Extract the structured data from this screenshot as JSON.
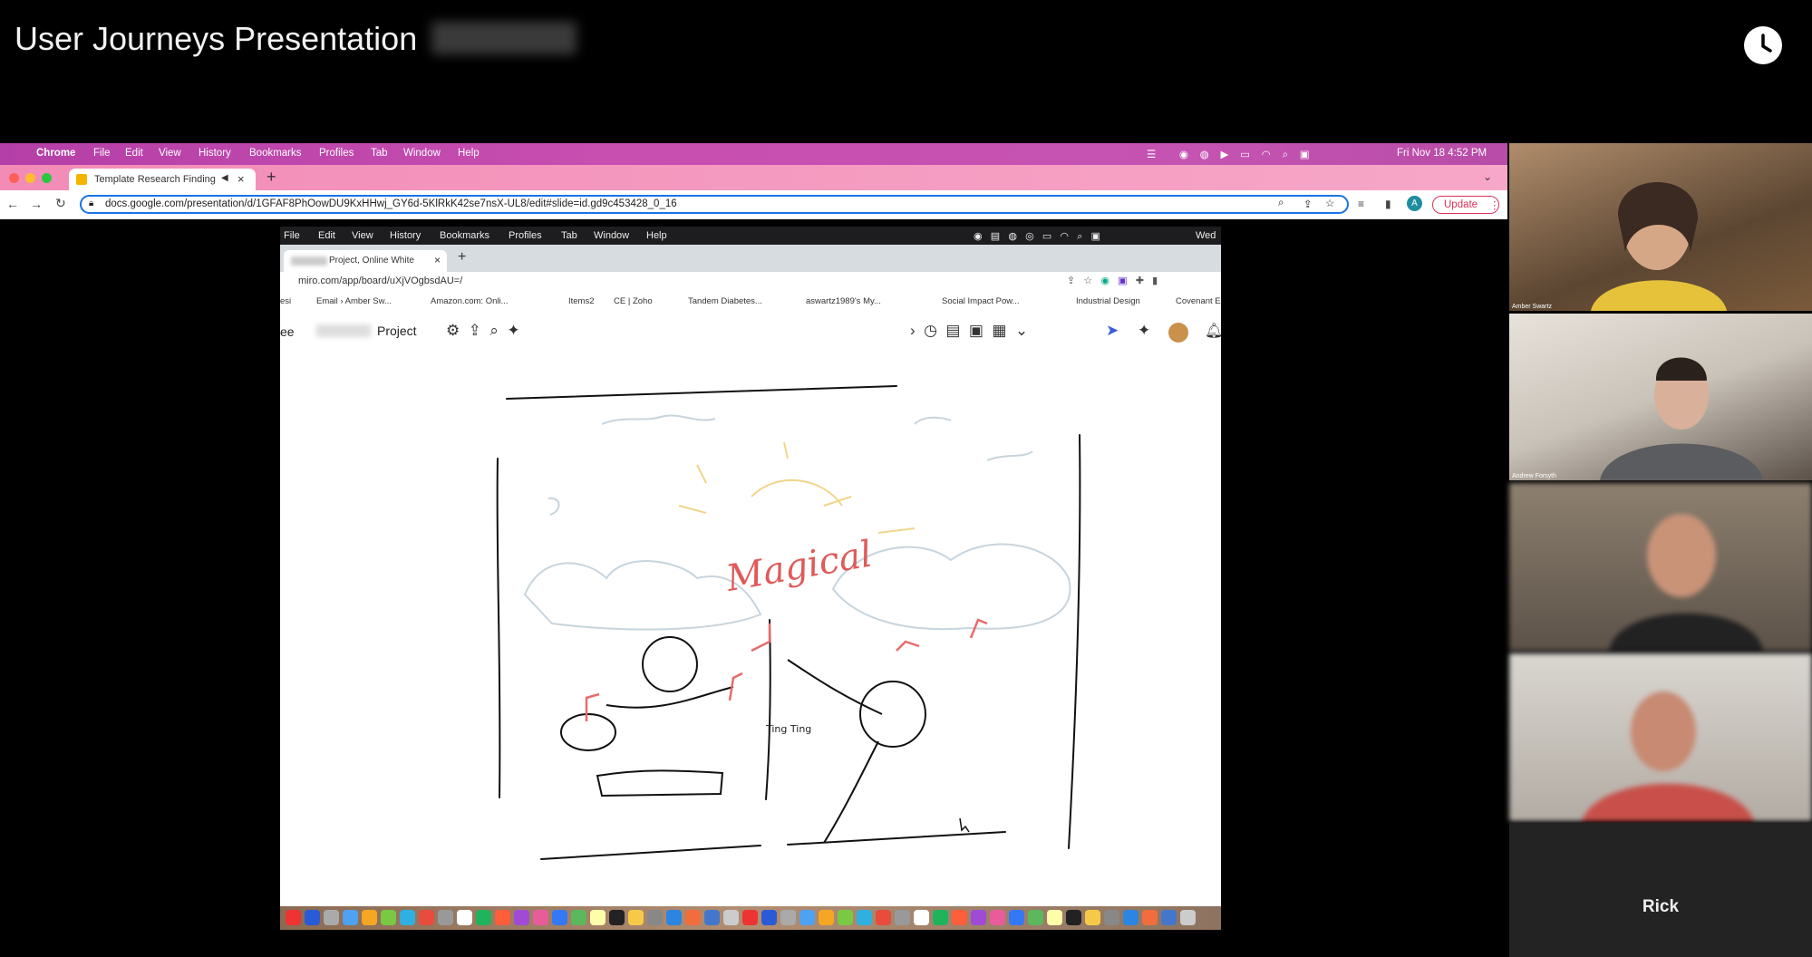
{
  "header": {
    "title": "User Journeys Presentation",
    "date_blurred": "22-11-18"
  },
  "browser": {
    "app_menu": [
      "Chrome",
      "File",
      "Edit",
      "View",
      "History",
      "Bookmarks",
      "Profiles",
      "Tab",
      "Window",
      "Help"
    ],
    "clock": "Fri Nov 18  4:52 PM",
    "tab_title": "Template Research Finding",
    "url": "docs.google.com/presentation/d/1GFAF8PhOowDU9KxHHwj_GY6d-5KlRkK42se7nsX-UL8/edit#slide=id.gd9c453428_0_16",
    "update_label": "Update",
    "profile_initial": "A"
  },
  "inner": {
    "menu": [
      "File",
      "Edit",
      "View",
      "History",
      "Bookmarks",
      "Profiles",
      "Tab",
      "Window",
      "Help"
    ],
    "clock_text": "Wed",
    "tab_title": "Project, Online White",
    "url": "miro.com/app/board/uXjVOgbsdAU=/",
    "bookmarks": [
      "Email › Amber Sw...",
      "Amazon.com: Onli...",
      "Items2",
      "CE | Zoho",
      "Tandem Diabetes...",
      "aswartz1989's My...",
      "Social Impact Pow...",
      "Industrial Design",
      "Covenant E"
    ],
    "board_name": "Project",
    "board_prefix": "ee",
    "sketch_word": "Magical",
    "sketch_ting": "Ting Ting"
  },
  "participants": [
    {
      "name": "Amber Swartz"
    },
    {
      "name": "Andrew Forsyth"
    },
    {
      "name": ""
    },
    {
      "name": ""
    },
    {
      "name": "Rick"
    }
  ]
}
